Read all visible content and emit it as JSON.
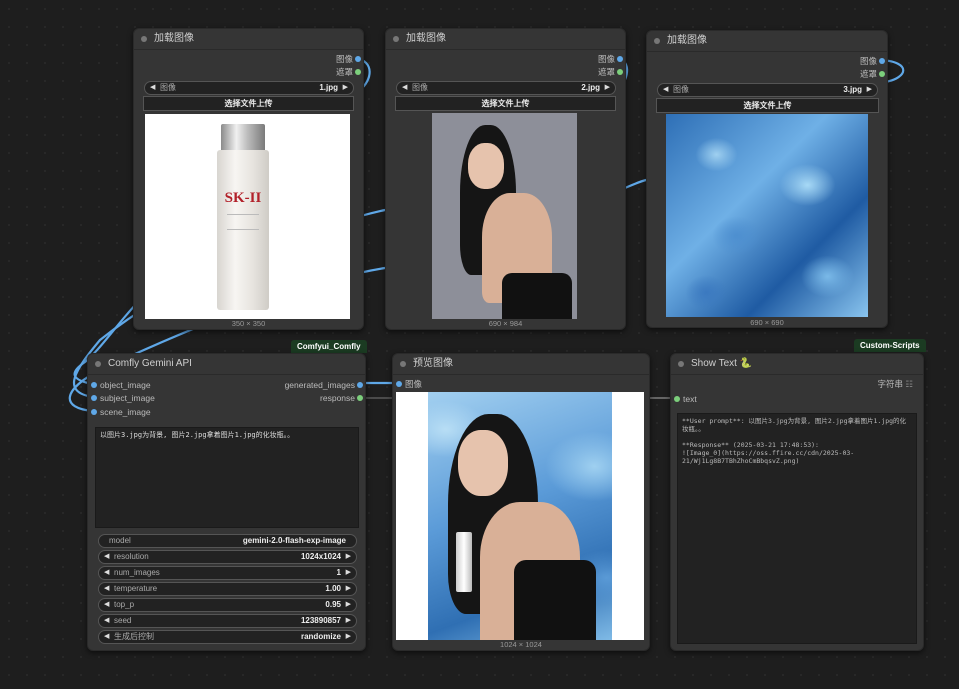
{
  "load_nodes": [
    {
      "title": "加载图像",
      "outputs": [
        "图像",
        "遮罩"
      ],
      "image_widget": {
        "label": "图像",
        "value": "1.jpg"
      },
      "upload_label": "选择文件上传",
      "size_caption": "350 × 350",
      "image": "sk-ii bottle"
    },
    {
      "title": "加载图像",
      "outputs": [
        "图像",
        "遮罩"
      ],
      "image_widget": {
        "label": "图像",
        "value": "2.jpg"
      },
      "upload_label": "选择文件上传",
      "size_caption": "690 × 984",
      "image": "woman portrait"
    },
    {
      "title": "加载图像",
      "outputs": [
        "图像",
        "遮罩"
      ],
      "image_widget": {
        "label": "图像",
        "value": "3.jpg"
      },
      "upload_label": "选择文件上传",
      "size_caption": "690 × 690",
      "image": "blue ice"
    }
  ],
  "badges": {
    "comfly": "Comfyui_Comfly",
    "custom": "Custom-Scripts"
  },
  "gemini": {
    "title": "Comfly Gemini API",
    "inputs": [
      "object_image",
      "subject_image",
      "scene_image"
    ],
    "outputs": [
      "generated_images",
      "response"
    ],
    "prompt": "以图片3.jpg为背景, 图片2.jpg拿着图片1.jpg的化妆瓶。。",
    "widgets": [
      {
        "label": "model",
        "value": "gemini-2.0-flash-exp-image",
        "arrows": false
      },
      {
        "label": "resolution",
        "value": "1024x1024",
        "arrows": true
      },
      {
        "label": "num_images",
        "value": "1",
        "arrows": true
      },
      {
        "label": "temperature",
        "value": "1.00",
        "arrows": true
      },
      {
        "label": "top_p",
        "value": "0.95",
        "arrows": true
      },
      {
        "label": "seed",
        "value": "123890857",
        "arrows": true
      },
      {
        "label": "生成后控制",
        "value": "randomize",
        "arrows": true
      }
    ]
  },
  "preview": {
    "title": "预览图像",
    "input": "图像",
    "size_caption": "1024 × 1024"
  },
  "show_text": {
    "title": "Show Text",
    "title_icon": "snake-icon",
    "input": "text",
    "output_label": "字符串",
    "output_icon": "grid-icon",
    "text": "**User prompt**: 以图片3.jpg为背景, 图片2.jpg拿着图片1.jpg的化妆瓶。。\n\n**Response** (2025-03-21 17:48:53):\n![Image_0](https://oss.ffire.cc/cdn/2025-03-21/Wj1Lg8B7TBhZhoCmBbqsvZ.png)"
  },
  "colors": {
    "image_port": "#5fa8e8",
    "mask_port": "#7ccf7c",
    "badge_bg": "#1b3b22",
    "canvas": "#1e1e1e"
  }
}
